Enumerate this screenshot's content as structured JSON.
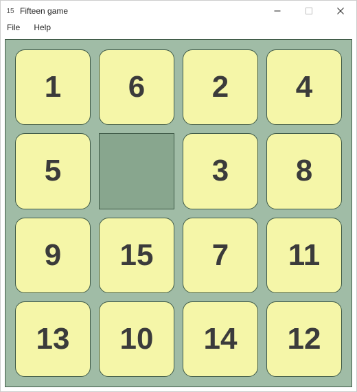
{
  "window": {
    "icon_text": "15",
    "title": "Fifteen game"
  },
  "menu": {
    "file": "File",
    "help": "Help"
  },
  "board": {
    "grid": [
      [
        1,
        6,
        2,
        4
      ],
      [
        5,
        null,
        3,
        8
      ],
      [
        9,
        15,
        7,
        11
      ],
      [
        13,
        10,
        14,
        12
      ]
    ]
  },
  "colors": {
    "board_bg": "#a0bca6",
    "tile_bg": "#f5f6a8",
    "empty_bg": "#88a68e",
    "tile_text": "#3b3b3b",
    "border": "#3f5a47"
  }
}
